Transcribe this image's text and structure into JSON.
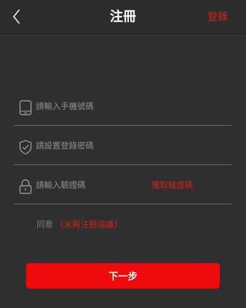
{
  "header": {
    "title": "注冊",
    "login_label": "登錄",
    "back_icon": "chevron-left-icon"
  },
  "form": {
    "phone": {
      "placeholder": "請輸入手機號碼",
      "icon": "phone-icon"
    },
    "password": {
      "placeholder": "請設置登錄密碼",
      "icon": "shield-icon"
    },
    "code": {
      "placeholder": "請輸入驗證碼",
      "icon": "lock-icon",
      "get_code_label": "獲取驗證碼"
    }
  },
  "agreement": {
    "prefix": "同意",
    "link": "《米殿注冊協議》"
  },
  "next_button": {
    "label": "下一步"
  },
  "colors": {
    "background": "#2f2f2f",
    "accent_red": "#d0241b",
    "button_red": "#ef0b0b",
    "text_gray": "#8e8e8e"
  }
}
